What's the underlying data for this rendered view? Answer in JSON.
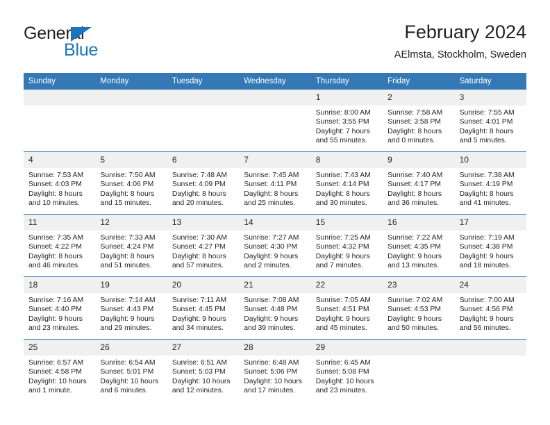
{
  "brand": {
    "name_part1": "General",
    "name_part2": "Blue",
    "triangle_color": "#1b75bb"
  },
  "header": {
    "title": "February 2024",
    "location": "AElmsta, Stockholm, Sweden"
  },
  "theme": {
    "header_blue": "#3479b5",
    "date_band_gray": "#f0f0f0",
    "text_color": "#231f20"
  },
  "weekdays": [
    "Sunday",
    "Monday",
    "Tuesday",
    "Wednesday",
    "Thursday",
    "Friday",
    "Saturday"
  ],
  "weeks": [
    [
      {
        "day": "",
        "sunrise": "",
        "sunset": "",
        "daylight_line1": "",
        "daylight_line2": ""
      },
      {
        "day": "",
        "sunrise": "",
        "sunset": "",
        "daylight_line1": "",
        "daylight_line2": ""
      },
      {
        "day": "",
        "sunrise": "",
        "sunset": "",
        "daylight_line1": "",
        "daylight_line2": ""
      },
      {
        "day": "",
        "sunrise": "",
        "sunset": "",
        "daylight_line1": "",
        "daylight_line2": ""
      },
      {
        "day": "1",
        "sunrise": "Sunrise: 8:00 AM",
        "sunset": "Sunset: 3:55 PM",
        "daylight_line1": "Daylight: 7 hours",
        "daylight_line2": "and 55 minutes."
      },
      {
        "day": "2",
        "sunrise": "Sunrise: 7:58 AM",
        "sunset": "Sunset: 3:58 PM",
        "daylight_line1": "Daylight: 8 hours",
        "daylight_line2": "and 0 minutes."
      },
      {
        "day": "3",
        "sunrise": "Sunrise: 7:55 AM",
        "sunset": "Sunset: 4:01 PM",
        "daylight_line1": "Daylight: 8 hours",
        "daylight_line2": "and 5 minutes."
      }
    ],
    [
      {
        "day": "4",
        "sunrise": "Sunrise: 7:53 AM",
        "sunset": "Sunset: 4:03 PM",
        "daylight_line1": "Daylight: 8 hours",
        "daylight_line2": "and 10 minutes."
      },
      {
        "day": "5",
        "sunrise": "Sunrise: 7:50 AM",
        "sunset": "Sunset: 4:06 PM",
        "daylight_line1": "Daylight: 8 hours",
        "daylight_line2": "and 15 minutes."
      },
      {
        "day": "6",
        "sunrise": "Sunrise: 7:48 AM",
        "sunset": "Sunset: 4:09 PM",
        "daylight_line1": "Daylight: 8 hours",
        "daylight_line2": "and 20 minutes."
      },
      {
        "day": "7",
        "sunrise": "Sunrise: 7:45 AM",
        "sunset": "Sunset: 4:11 PM",
        "daylight_line1": "Daylight: 8 hours",
        "daylight_line2": "and 25 minutes."
      },
      {
        "day": "8",
        "sunrise": "Sunrise: 7:43 AM",
        "sunset": "Sunset: 4:14 PM",
        "daylight_line1": "Daylight: 8 hours",
        "daylight_line2": "and 30 minutes."
      },
      {
        "day": "9",
        "sunrise": "Sunrise: 7:40 AM",
        "sunset": "Sunset: 4:17 PM",
        "daylight_line1": "Daylight: 8 hours",
        "daylight_line2": "and 36 minutes."
      },
      {
        "day": "10",
        "sunrise": "Sunrise: 7:38 AM",
        "sunset": "Sunset: 4:19 PM",
        "daylight_line1": "Daylight: 8 hours",
        "daylight_line2": "and 41 minutes."
      }
    ],
    [
      {
        "day": "11",
        "sunrise": "Sunrise: 7:35 AM",
        "sunset": "Sunset: 4:22 PM",
        "daylight_line1": "Daylight: 8 hours",
        "daylight_line2": "and 46 minutes."
      },
      {
        "day": "12",
        "sunrise": "Sunrise: 7:33 AM",
        "sunset": "Sunset: 4:24 PM",
        "daylight_line1": "Daylight: 8 hours",
        "daylight_line2": "and 51 minutes."
      },
      {
        "day": "13",
        "sunrise": "Sunrise: 7:30 AM",
        "sunset": "Sunset: 4:27 PM",
        "daylight_line1": "Daylight: 8 hours",
        "daylight_line2": "and 57 minutes."
      },
      {
        "day": "14",
        "sunrise": "Sunrise: 7:27 AM",
        "sunset": "Sunset: 4:30 PM",
        "daylight_line1": "Daylight: 9 hours",
        "daylight_line2": "and 2 minutes."
      },
      {
        "day": "15",
        "sunrise": "Sunrise: 7:25 AM",
        "sunset": "Sunset: 4:32 PM",
        "daylight_line1": "Daylight: 9 hours",
        "daylight_line2": "and 7 minutes."
      },
      {
        "day": "16",
        "sunrise": "Sunrise: 7:22 AM",
        "sunset": "Sunset: 4:35 PM",
        "daylight_line1": "Daylight: 9 hours",
        "daylight_line2": "and 13 minutes."
      },
      {
        "day": "17",
        "sunrise": "Sunrise: 7:19 AM",
        "sunset": "Sunset: 4:38 PM",
        "daylight_line1": "Daylight: 9 hours",
        "daylight_line2": "and 18 minutes."
      }
    ],
    [
      {
        "day": "18",
        "sunrise": "Sunrise: 7:16 AM",
        "sunset": "Sunset: 4:40 PM",
        "daylight_line1": "Daylight: 9 hours",
        "daylight_line2": "and 23 minutes."
      },
      {
        "day": "19",
        "sunrise": "Sunrise: 7:14 AM",
        "sunset": "Sunset: 4:43 PM",
        "daylight_line1": "Daylight: 9 hours",
        "daylight_line2": "and 29 minutes."
      },
      {
        "day": "20",
        "sunrise": "Sunrise: 7:11 AM",
        "sunset": "Sunset: 4:45 PM",
        "daylight_line1": "Daylight: 9 hours",
        "daylight_line2": "and 34 minutes."
      },
      {
        "day": "21",
        "sunrise": "Sunrise: 7:08 AM",
        "sunset": "Sunset: 4:48 PM",
        "daylight_line1": "Daylight: 9 hours",
        "daylight_line2": "and 39 minutes."
      },
      {
        "day": "22",
        "sunrise": "Sunrise: 7:05 AM",
        "sunset": "Sunset: 4:51 PM",
        "daylight_line1": "Daylight: 9 hours",
        "daylight_line2": "and 45 minutes."
      },
      {
        "day": "23",
        "sunrise": "Sunrise: 7:02 AM",
        "sunset": "Sunset: 4:53 PM",
        "daylight_line1": "Daylight: 9 hours",
        "daylight_line2": "and 50 minutes."
      },
      {
        "day": "24",
        "sunrise": "Sunrise: 7:00 AM",
        "sunset": "Sunset: 4:56 PM",
        "daylight_line1": "Daylight: 9 hours",
        "daylight_line2": "and 56 minutes."
      }
    ],
    [
      {
        "day": "25",
        "sunrise": "Sunrise: 6:57 AM",
        "sunset": "Sunset: 4:58 PM",
        "daylight_line1": "Daylight: 10 hours",
        "daylight_line2": "and 1 minute."
      },
      {
        "day": "26",
        "sunrise": "Sunrise: 6:54 AM",
        "sunset": "Sunset: 5:01 PM",
        "daylight_line1": "Daylight: 10 hours",
        "daylight_line2": "and 6 minutes."
      },
      {
        "day": "27",
        "sunrise": "Sunrise: 6:51 AM",
        "sunset": "Sunset: 5:03 PM",
        "daylight_line1": "Daylight: 10 hours",
        "daylight_line2": "and 12 minutes."
      },
      {
        "day": "28",
        "sunrise": "Sunrise: 6:48 AM",
        "sunset": "Sunset: 5:06 PM",
        "daylight_line1": "Daylight: 10 hours",
        "daylight_line2": "and 17 minutes."
      },
      {
        "day": "29",
        "sunrise": "Sunrise: 6:45 AM",
        "sunset": "Sunset: 5:08 PM",
        "daylight_line1": "Daylight: 10 hours",
        "daylight_line2": "and 23 minutes."
      },
      {
        "day": "",
        "sunrise": "",
        "sunset": "",
        "daylight_line1": "",
        "daylight_line2": ""
      },
      {
        "day": "",
        "sunrise": "",
        "sunset": "",
        "daylight_line1": "",
        "daylight_line2": ""
      }
    ]
  ]
}
